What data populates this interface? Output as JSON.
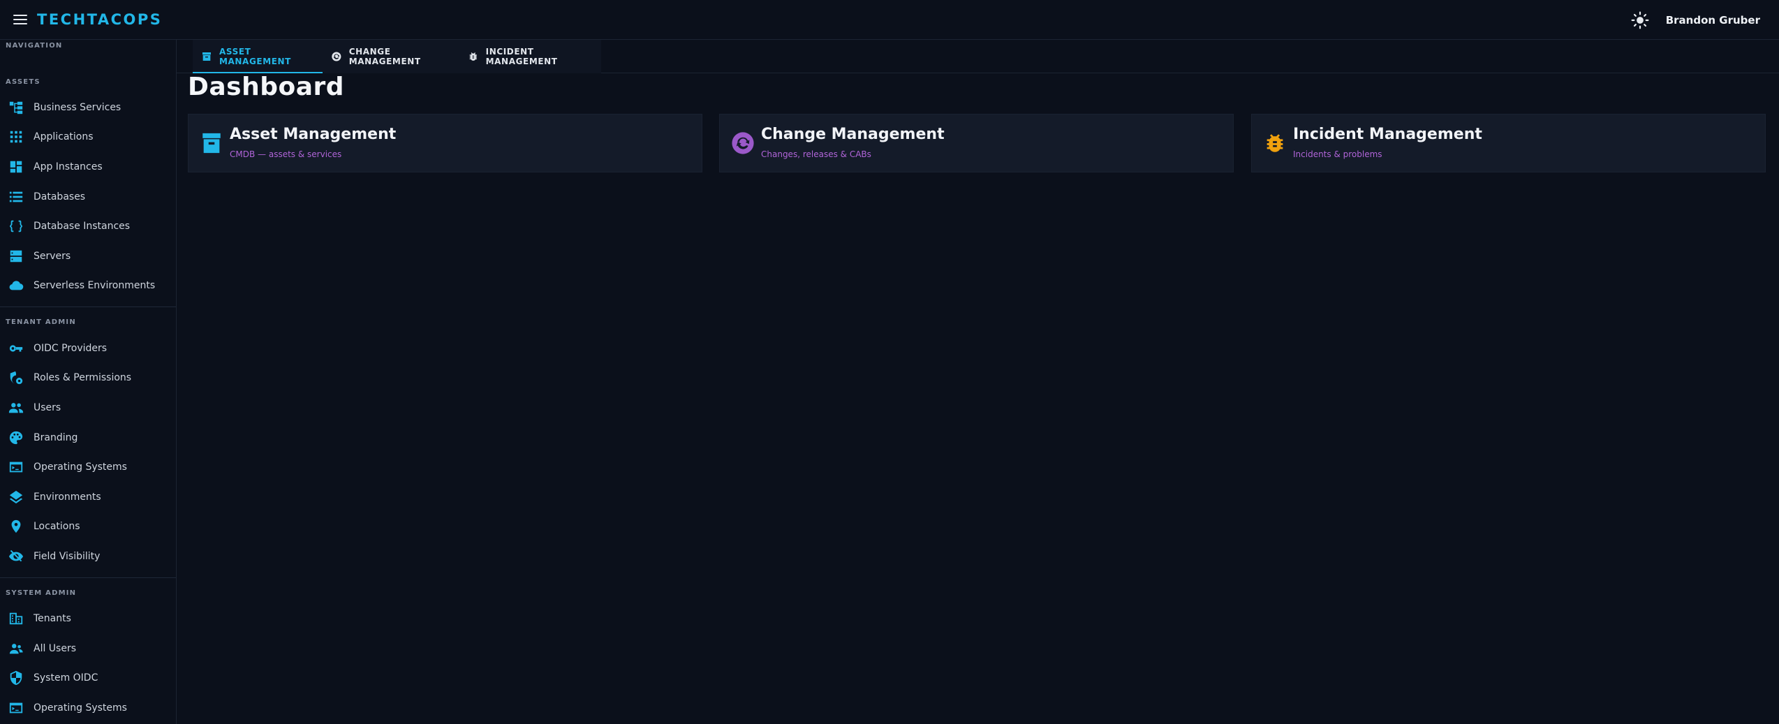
{
  "header": {
    "brand": "TECHTACOPS",
    "username": "Brandon Gruber",
    "icons": {
      "menu": "hamburger-menu-icon",
      "theme": "sun-icon"
    }
  },
  "sidebar": {
    "nav_title": "NAVIGATION",
    "sections": [
      {
        "title": "ASSETS",
        "items": [
          {
            "label": "Business Services",
            "icon": "hierarchy-icon"
          },
          {
            "label": "Applications",
            "icon": "apps-grid-icon"
          },
          {
            "label": "App Instances",
            "icon": "dashboard-tiles-icon"
          },
          {
            "label": "Databases",
            "icon": "database-list-icon"
          },
          {
            "label": "Database Instances",
            "icon": "braces-icon"
          },
          {
            "label": "Servers",
            "icon": "server-icon"
          },
          {
            "label": "Serverless Environments",
            "icon": "cloud-icon"
          }
        ]
      },
      {
        "title": "TENANT ADMIN",
        "items": [
          {
            "label": "OIDC Providers",
            "icon": "key-icon"
          },
          {
            "label": "Roles & Permissions",
            "icon": "shield-gear-icon"
          },
          {
            "label": "Users",
            "icon": "people-icon"
          },
          {
            "label": "Branding",
            "icon": "palette-icon"
          },
          {
            "label": "Operating Systems",
            "icon": "terminal-icon"
          },
          {
            "label": "Environments",
            "icon": "layers-icon"
          },
          {
            "label": "Locations",
            "icon": "location-pin-icon"
          },
          {
            "label": "Field Visibility",
            "icon": "eye-off-icon"
          }
        ]
      },
      {
        "title": "SYSTEM ADMIN",
        "items": [
          {
            "label": "Tenants",
            "icon": "building-icon"
          },
          {
            "label": "All Users",
            "icon": "people-outline-icon"
          },
          {
            "label": "System OIDC",
            "icon": "shield-icon"
          },
          {
            "label": "Operating Systems",
            "icon": "terminal-icon"
          }
        ]
      }
    ]
  },
  "tabs": [
    {
      "label": "ASSET MANAGEMENT",
      "icon": "archive-box-icon",
      "active": true
    },
    {
      "label": "CHANGE MANAGEMENT",
      "icon": "sync-circle-icon",
      "active": false
    },
    {
      "label": "INCIDENT MANAGEMENT",
      "icon": "bug-icon",
      "active": false
    }
  ],
  "main": {
    "title": "Dashboard",
    "cards": [
      {
        "title": "Asset Management",
        "subtitle": "CMDB — assets & services",
        "icon": "archive-box-icon",
        "icon_color": "#22b7e8"
      },
      {
        "title": "Change Management",
        "subtitle": "Changes, releases & CABs",
        "icon": "sync-circle-icon",
        "icon_color": "#9b59c9"
      },
      {
        "title": "Incident Management",
        "subtitle": "Incidents & problems",
        "icon": "bug-icon",
        "icon_color": "#f0a10e"
      }
    ]
  },
  "colors": {
    "accent": "#22b7e8",
    "background": "#0b101b",
    "card": "#141b29",
    "subtitle": "#b064d8"
  }
}
